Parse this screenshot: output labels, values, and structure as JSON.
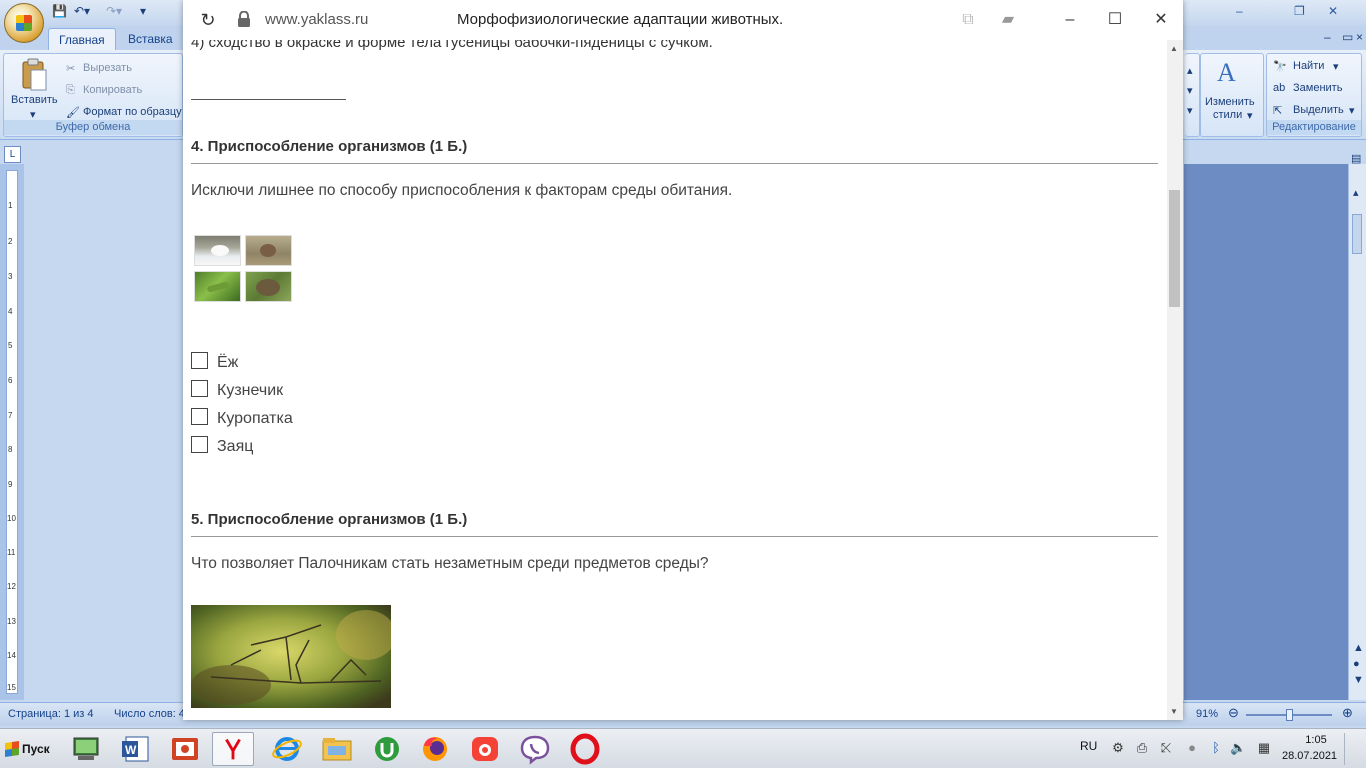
{
  "word": {
    "tabs": [
      "Главная",
      "Вставка"
    ],
    "clipboard": {
      "paste": "Вставить",
      "cut": "Вырезать",
      "copy": "Копировать",
      "format_painter": "Формат по образцу",
      "group_label": "Буфер обмена"
    },
    "styles": {
      "change_styles": "Изменить стили",
      "change_styles_line1": "Изменить",
      "change_styles_line2": "стили"
    },
    "editing": {
      "find": "Найти",
      "replace": "Заменить",
      "select": "Выделить",
      "group_label": "Редактирование"
    },
    "ruler_corner": "L",
    "ruler_marks": [
      "1",
      "2",
      "3",
      "4",
      "5",
      "6",
      "7",
      "8",
      "9",
      "10",
      "11",
      "12",
      "13",
      "14",
      "15"
    ],
    "status": {
      "page": "Страница: 1 из 4",
      "words": "Число слов: 4",
      "zoom": "91%"
    }
  },
  "browser": {
    "url": "www.yaklass.ru",
    "title": "Морфофизиологические адаптации животных.",
    "prev_answer_text": "4) сходство в окраске и форме тела гусеницы бабочки-пяденицы с сучком.",
    "questions": [
      {
        "header": "4.  Приспособление организмов  (1 Б.)",
        "text": "Исключи лишнее по способу приспособления к факторам среды обитания.",
        "images": [
          "hare-photo",
          "partridge-photo",
          "grasshopper-photo",
          "hedgehog-photo"
        ],
        "options": [
          "Ёж",
          "Кузнечик",
          "Куропатка",
          "Заяц"
        ]
      },
      {
        "header": "5.  Приспособление организмов  (1 Б.)",
        "text": "Что позволяет Палочникам стать незаметным среди предметов среды?",
        "image": "stick-insect-photo"
      }
    ]
  },
  "taskbar": {
    "start_label": "Пуск",
    "apps": [
      "computer-app",
      "word-app",
      "powerpoint-app",
      "yandex-app",
      "ie-app",
      "explorer-app",
      "utorrent-app",
      "firefox-app",
      "screencast-app",
      "viber-app",
      "opera-app"
    ],
    "language": "RU",
    "time": "1:05",
    "date": "28.07.2021"
  }
}
